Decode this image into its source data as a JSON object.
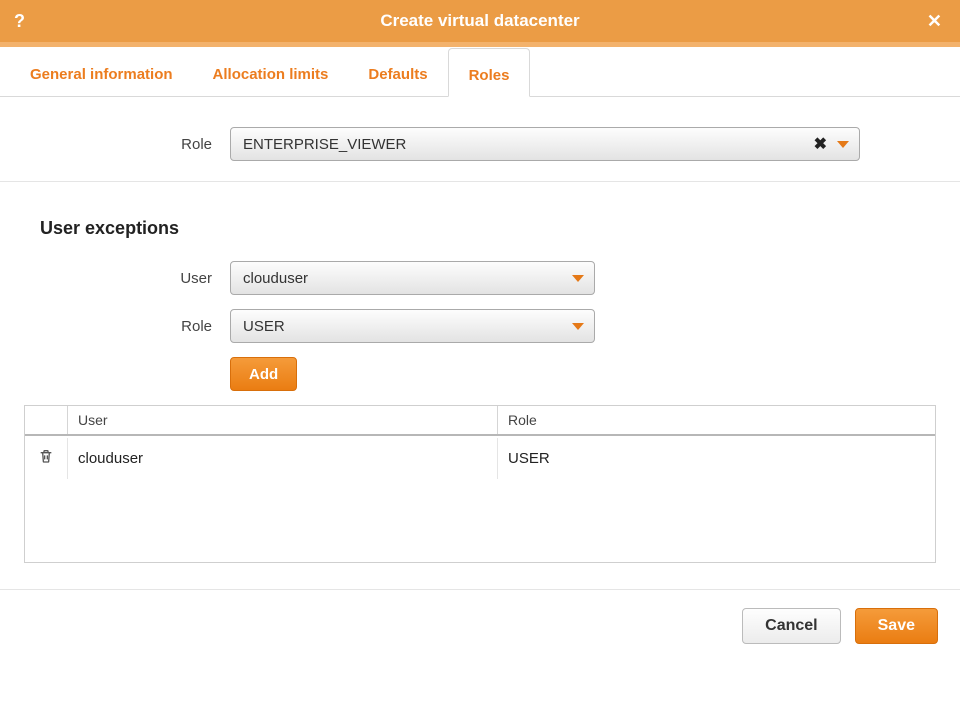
{
  "colors": {
    "accent": "#ec7d1f",
    "header": "#eb9c45"
  },
  "header": {
    "title": "Create virtual datacenter"
  },
  "tabs": [
    {
      "label": "General information",
      "active": false
    },
    {
      "label": "Allocation limits",
      "active": false
    },
    {
      "label": "Defaults",
      "active": false
    },
    {
      "label": "Roles",
      "active": true
    }
  ],
  "role_field": {
    "label": "Role",
    "value": "ENTERPRISE_VIEWER"
  },
  "exceptions": {
    "title": "User exceptions",
    "user_field": {
      "label": "User",
      "value": "clouduser"
    },
    "role_field": {
      "label": "Role",
      "value": "USER"
    },
    "add_label": "Add",
    "columns": {
      "user": "User",
      "role": "Role"
    },
    "rows": [
      {
        "user": "clouduser",
        "role": "USER"
      }
    ]
  },
  "footer": {
    "cancel": "Cancel",
    "save": "Save"
  }
}
